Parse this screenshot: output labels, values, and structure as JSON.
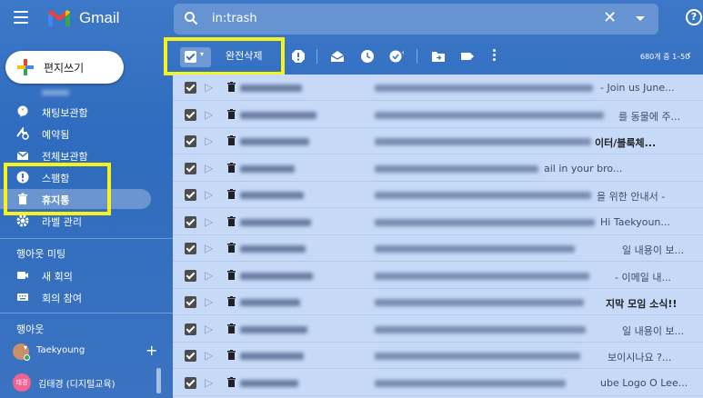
{
  "app": {
    "brand": "Gmail"
  },
  "search": {
    "value": "in:trash"
  },
  "compose": {
    "label": "편지쓰기"
  },
  "sidebar": {
    "items": [
      {
        "label": "채팅보관함",
        "icon": "chat-archive-icon"
      },
      {
        "label": "예약됨",
        "icon": "scheduled-icon"
      },
      {
        "label": "전체보관함",
        "icon": "all-mail-icon"
      },
      {
        "label": "스팸함",
        "icon": "spam-icon"
      },
      {
        "label": "휴지통",
        "icon": "trash-icon"
      },
      {
        "label": "라벨 관리",
        "icon": "gear-icon"
      }
    ],
    "meet": {
      "header": "행아웃 미팅",
      "new_meeting": "새 회의",
      "join": "회의 참여"
    },
    "hangouts": {
      "header": "행아웃",
      "user": "Taekyoung",
      "contact": "김태경 (디지털교육)",
      "contact_avatar": "태경"
    }
  },
  "toolbar": {
    "delete_forever": "완전삭제",
    "counter": "680개 중 1–50"
  },
  "rows": [
    {
      "tail": "- Join us June..."
    },
    {
      "tail": "를 동물에 주..."
    },
    {
      "tail": "이터/블룩체...",
      "bold": true
    },
    {
      "tail": "ail in your bro..."
    },
    {
      "tail": "을 위한 안내서 -"
    },
    {
      "tail": "Hi Taekyoun..."
    },
    {
      "tail": "일 내용이 보..."
    },
    {
      "tail": "- 이메일 내..."
    },
    {
      "tail": "지막 모임 소식!!",
      "bold": true
    },
    {
      "tail": "일 내용이 보..."
    },
    {
      "tail": "보이시나요 ?..."
    },
    {
      "tail": "ube Logo O Lee..."
    }
  ],
  "colors": {
    "accent": "#3b73c0",
    "highlight": "#f6f21c",
    "list_bg": "#c6daf8"
  }
}
